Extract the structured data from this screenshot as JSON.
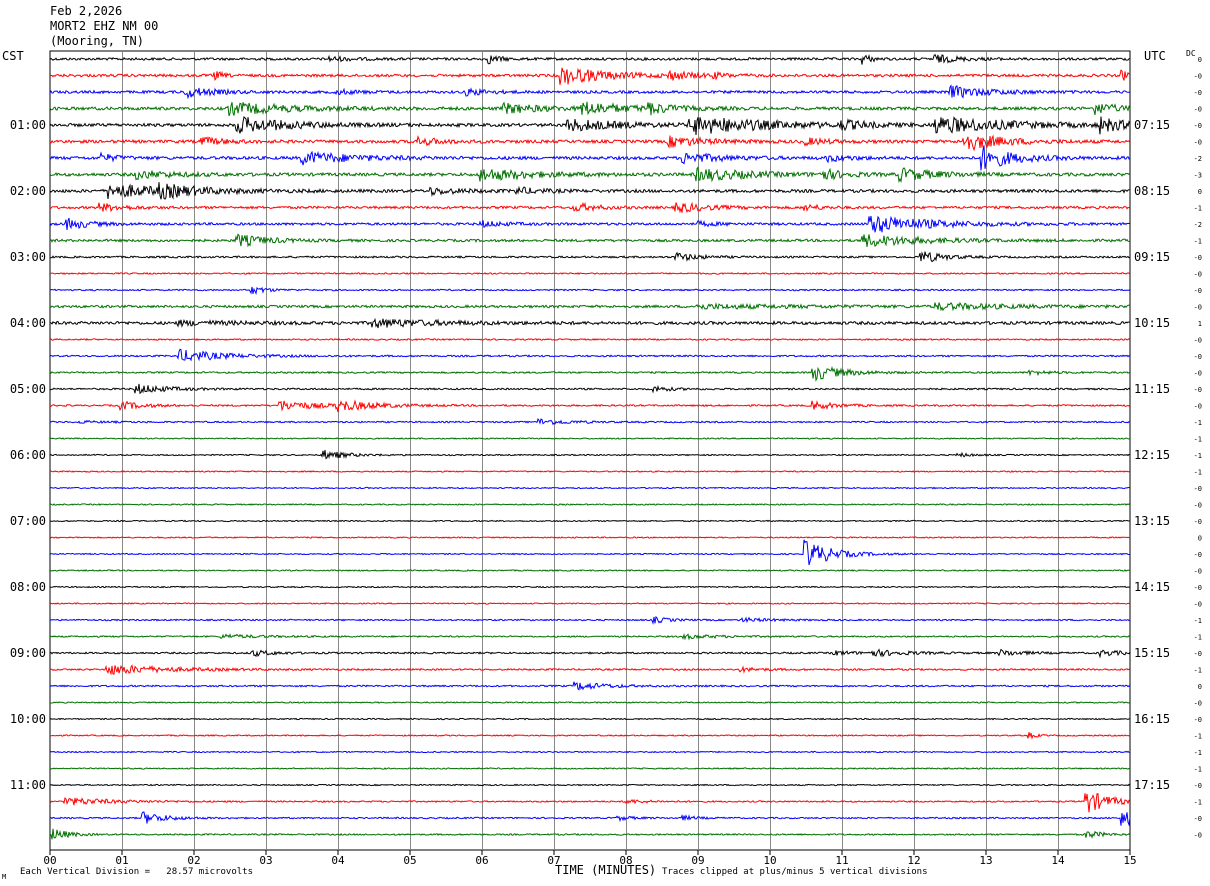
{
  "header": {
    "date": "Feb 2,2026",
    "station": "MORT2 EHZ NM 00",
    "location": "(Mooring, TN)"
  },
  "left_timezone": "CST",
  "right_timezone": "UTC",
  "dc_label": "DC",
  "footer": {
    "scale_note": "Each Vertical Division =   28.57 microvolts",
    "xlabel": "TIME (MINUTES)",
    "clip_note": "Traces clipped at plus/minus 5 vertical divisions",
    "corner_mark": "M"
  },
  "chart_data": {
    "type": "line",
    "xlabel": "TIME (MINUTES)",
    "xlim": [
      0,
      15
    ],
    "x_ticks": [
      "00",
      "01",
      "02",
      "03",
      "04",
      "05",
      "06",
      "07",
      "08",
      "09",
      "10",
      "11",
      "12",
      "13",
      "14",
      "15"
    ],
    "trace_colors": [
      "#000000",
      "#ff0000",
      "#0000ff",
      "#007000"
    ],
    "left_hour_labels": [
      "01:00",
      "02:00",
      "03:00",
      "04:00",
      "05:00",
      "06:00",
      "07:00",
      "08:00",
      "09:00",
      "10:00",
      "11:00"
    ],
    "right_hour_labels": [
      "07:15",
      "08:15",
      "09:15",
      "10:15",
      "11:15",
      "12:15",
      "13:15",
      "14:15",
      "15:15",
      "16:15",
      "17:15"
    ],
    "dc_offsets": [
      "0",
      "-0",
      "-0",
      "-0",
      "-0",
      "-0",
      "-2",
      "-3",
      "0",
      "-1",
      "-2",
      "-1",
      "-0",
      "-0",
      "-0",
      "-0",
      "1",
      "-0",
      "-0",
      "-0",
      "-0",
      "-0",
      "-1",
      "-1",
      "-1",
      "-1",
      "-0",
      "-0",
      "-0",
      "0",
      "-0",
      "-0",
      "-0",
      "-0",
      "-1",
      "-1",
      "-0",
      "-1",
      "0",
      "-0",
      "-0",
      "-1",
      "-1",
      "-1",
      "-0",
      "-1",
      "-0",
      "-0"
    ],
    "series": [
      {
        "trace": 0,
        "base": 1.2,
        "events": [
          {
            "x": 6.1,
            "amp": 4,
            "dur": 0.15
          },
          {
            "x": 11.3,
            "amp": 5,
            "dur": 0.1
          },
          {
            "x": 12.3,
            "amp": 4,
            "dur": 0.3
          },
          {
            "x": 3.9,
            "amp": 2,
            "dur": 0.3
          }
        ]
      },
      {
        "trace": 1,
        "base": 1.3,
        "events": [
          {
            "x": 7.1,
            "amp": 9,
            "dur": 0.6
          },
          {
            "x": 2.3,
            "amp": 4,
            "dur": 0.1
          },
          {
            "x": 8.6,
            "amp": 4,
            "dur": 0.3
          },
          {
            "x": 9.2,
            "amp": 2,
            "dur": 0.2
          },
          {
            "x": 14.9,
            "amp": 4,
            "dur": 0.3
          }
        ]
      },
      {
        "trace": 2,
        "base": 1.3,
        "events": [
          {
            "x": 1.9,
            "amp": 5,
            "dur": 0.35
          },
          {
            "x": 4.0,
            "amp": 2,
            "dur": 0.3
          },
          {
            "x": 5.8,
            "amp": 3,
            "dur": 0.3
          },
          {
            "x": 12.5,
            "amp": 6,
            "dur": 0.5
          }
        ]
      },
      {
        "trace": 3,
        "base": 1.5,
        "events": [
          {
            "x": 2.5,
            "amp": 6,
            "dur": 0.8
          },
          {
            "x": 6.3,
            "amp": 5,
            "dur": 0.5
          },
          {
            "x": 7.4,
            "amp": 6,
            "dur": 0.6
          },
          {
            "x": 8.3,
            "amp": 5,
            "dur": 0.3
          },
          {
            "x": 14.5,
            "amp": 6,
            "dur": 0.3
          }
        ]
      },
      {
        "trace": 4,
        "base": 1.5,
        "events": [
          {
            "x": 2.6,
            "amp": 8,
            "dur": 0.7
          },
          {
            "x": 7.2,
            "amp": 6,
            "dur": 0.7
          },
          {
            "x": 8.9,
            "amp": 9,
            "dur": 1.0
          },
          {
            "x": 12.3,
            "amp": 8,
            "dur": 1.0
          },
          {
            "x": 14.6,
            "amp": 7,
            "dur": 0.3
          },
          {
            "x": 11.0,
            "amp": 4,
            "dur": 0.3
          }
        ]
      },
      {
        "trace": 5,
        "base": 1.5,
        "events": [
          {
            "x": 2.1,
            "amp": 4,
            "dur": 0.3
          },
          {
            "x": 5.1,
            "amp": 4,
            "dur": 0.3
          },
          {
            "x": 8.6,
            "amp": 5,
            "dur": 0.5
          },
          {
            "x": 12.7,
            "amp": 9,
            "dur": 0.5
          },
          {
            "x": 10.5,
            "amp": 3,
            "dur": 0.3
          }
        ]
      },
      {
        "trace": 6,
        "base": 1.5,
        "events": [
          {
            "x": 0.7,
            "amp": 4,
            "dur": 0.2
          },
          {
            "x": 3.5,
            "amp": 6,
            "dur": 0.7
          },
          {
            "x": 8.8,
            "amp": 5,
            "dur": 0.5
          },
          {
            "x": 12.95,
            "amp": 12,
            "dur": 0.4
          },
          {
            "x": 10.8,
            "amp": 3,
            "dur": 0.3
          }
        ]
      },
      {
        "trace": 7,
        "base": 1.5,
        "events": [
          {
            "x": 1.2,
            "amp": 4,
            "dur": 0.5
          },
          {
            "x": 6.0,
            "amp": 6,
            "dur": 0.7
          },
          {
            "x": 9.0,
            "amp": 6,
            "dur": 0.7
          },
          {
            "x": 10.7,
            "amp": 5,
            "dur": 0.3
          },
          {
            "x": 11.8,
            "amp": 6,
            "dur": 0.5
          }
        ]
      },
      {
        "trace": 8,
        "base": 1.5,
        "events": [
          {
            "x": 0.8,
            "amp": 7,
            "dur": 0.8
          },
          {
            "x": 1.5,
            "amp": 5,
            "dur": 0.5
          },
          {
            "x": 5.3,
            "amp": 3,
            "dur": 0.4
          },
          {
            "x": 6.5,
            "amp": 3,
            "dur": 0.3
          }
        ]
      },
      {
        "trace": 9,
        "base": 1.2,
        "events": [
          {
            "x": 0.7,
            "amp": 4,
            "dur": 0.3
          },
          {
            "x": 7.3,
            "amp": 4,
            "dur": 0.3
          },
          {
            "x": 8.7,
            "amp": 5,
            "dur": 0.4
          },
          {
            "x": 10.5,
            "amp": 3,
            "dur": 0.2
          }
        ]
      },
      {
        "trace": 10,
        "base": 1.2,
        "events": [
          {
            "x": 0.25,
            "amp": 5,
            "dur": 0.3
          },
          {
            "x": 6.0,
            "amp": 3,
            "dur": 0.3
          },
          {
            "x": 11.4,
            "amp": 9,
            "dur": 0.8
          },
          {
            "x": 9.0,
            "amp": 2,
            "dur": 0.3
          }
        ]
      },
      {
        "trace": 11,
        "base": 1.2,
        "events": [
          {
            "x": 2.6,
            "amp": 6,
            "dur": 0.4
          },
          {
            "x": 11.3,
            "amp": 6,
            "dur": 0.8
          }
        ]
      },
      {
        "trace": 12,
        "base": 0.9,
        "events": [
          {
            "x": 8.7,
            "amp": 4,
            "dur": 0.3
          },
          {
            "x": 12.1,
            "amp": 6,
            "dur": 0.3
          }
        ]
      },
      {
        "trace": 13,
        "base": 0.7,
        "events": []
      },
      {
        "trace": 14,
        "base": 0.7,
        "events": [
          {
            "x": 2.8,
            "amp": 4,
            "dur": 0.2
          }
        ]
      },
      {
        "trace": 15,
        "base": 1.2,
        "events": [
          {
            "x": 9.0,
            "amp": 2,
            "dur": 1.5
          },
          {
            "x": 12.3,
            "amp": 3,
            "dur": 1.0
          }
        ]
      },
      {
        "trace": 16,
        "base": 1.5,
        "events": [
          {
            "x": 4.5,
            "amp": 4,
            "dur": 0.8
          },
          {
            "x": 1.8,
            "amp": 2,
            "dur": 0.8
          }
        ]
      },
      {
        "trace": 17,
        "base": 0.7,
        "events": []
      },
      {
        "trace": 18,
        "base": 0.8,
        "events": [
          {
            "x": 1.8,
            "amp": 6,
            "dur": 0.6
          }
        ]
      },
      {
        "trace": 19,
        "base": 0.8,
        "events": [
          {
            "x": 10.6,
            "amp": 8,
            "dur": 0.4
          },
          {
            "x": 13.6,
            "amp": 2,
            "dur": 0.3
          }
        ]
      },
      {
        "trace": 20,
        "base": 0.8,
        "events": [
          {
            "x": 1.2,
            "amp": 5,
            "dur": 0.4
          },
          {
            "x": 8.4,
            "amp": 3,
            "dur": 0.2
          }
        ]
      },
      {
        "trace": 21,
        "base": 0.8,
        "events": [
          {
            "x": 1.0,
            "amp": 4,
            "dur": 0.3
          },
          {
            "x": 3.2,
            "amp": 5,
            "dur": 0.5
          },
          {
            "x": 4.0,
            "amp": 5,
            "dur": 0.5
          },
          {
            "x": 10.6,
            "amp": 4,
            "dur": 0.3
          }
        ]
      },
      {
        "trace": 22,
        "base": 0.7,
        "events": [
          {
            "x": 6.8,
            "amp": 3,
            "dur": 0.4
          },
          {
            "x": 0.4,
            "amp": 1,
            "dur": 0.4
          }
        ]
      },
      {
        "trace": 23,
        "base": 0.6,
        "events": []
      },
      {
        "trace": 24,
        "base": 0.6,
        "events": [
          {
            "x": 3.8,
            "amp": 5,
            "dur": 0.3
          },
          {
            "x": 12.6,
            "amp": 2,
            "dur": 0.2
          }
        ]
      },
      {
        "trace": 25,
        "base": 0.6,
        "events": []
      },
      {
        "trace": 26,
        "base": 0.6,
        "events": []
      },
      {
        "trace": 27,
        "base": 0.6,
        "events": []
      },
      {
        "trace": 28,
        "base": 0.6,
        "events": []
      },
      {
        "trace": 29,
        "base": 0.6,
        "events": []
      },
      {
        "trace": 30,
        "base": 0.6,
        "events": [
          {
            "x": 10.5,
            "amp": 14,
            "dur": 0.35
          }
        ]
      },
      {
        "trace": 31,
        "base": 0.6,
        "events": []
      },
      {
        "trace": 32,
        "base": 0.6,
        "events": []
      },
      {
        "trace": 33,
        "base": 0.6,
        "events": []
      },
      {
        "trace": 34,
        "base": 0.7,
        "events": [
          {
            "x": 8.4,
            "amp": 3,
            "dur": 0.2
          },
          {
            "x": 9.6,
            "amp": 2,
            "dur": 0.4
          }
        ]
      },
      {
        "trace": 35,
        "base": 0.7,
        "events": [
          {
            "x": 2.4,
            "amp": 2,
            "dur": 0.5
          },
          {
            "x": 8.8,
            "amp": 2,
            "dur": 0.5
          }
        ]
      },
      {
        "trace": 36,
        "base": 0.8,
        "events": [
          {
            "x": 2.8,
            "amp": 3,
            "dur": 0.3
          },
          {
            "x": 11.4,
            "amp": 3,
            "dur": 0.5
          },
          {
            "x": 13.2,
            "amp": 3,
            "dur": 0.3
          },
          {
            "x": 14.6,
            "amp": 3,
            "dur": 0.3
          },
          {
            "x": 10.9,
            "amp": 2,
            "dur": 0.3
          }
        ]
      },
      {
        "trace": 37,
        "base": 0.8,
        "events": [
          {
            "x": 0.8,
            "amp": 5,
            "dur": 0.8
          },
          {
            "x": 9.6,
            "amp": 2,
            "dur": 0.3
          }
        ]
      },
      {
        "trace": 38,
        "base": 0.8,
        "events": [
          {
            "x": 7.3,
            "amp": 4,
            "dur": 0.4
          }
        ]
      },
      {
        "trace": 39,
        "base": 0.6,
        "events": []
      },
      {
        "trace": 40,
        "base": 0.6,
        "events": []
      },
      {
        "trace": 41,
        "base": 0.6,
        "events": [
          {
            "x": 13.6,
            "amp": 3,
            "dur": 0.1
          }
        ]
      },
      {
        "trace": 42,
        "base": 0.6,
        "events": []
      },
      {
        "trace": 43,
        "base": 0.6,
        "events": []
      },
      {
        "trace": 44,
        "base": 0.6,
        "events": []
      },
      {
        "trace": 45,
        "base": 0.7,
        "events": [
          {
            "x": 0.2,
            "amp": 4,
            "dur": 0.6
          },
          {
            "x": 14.4,
            "amp": 12,
            "dur": 0.3
          },
          {
            "x": 8.0,
            "amp": 2,
            "dur": 0.3
          }
        ]
      },
      {
        "trace": 46,
        "base": 0.7,
        "events": [
          {
            "x": 1.3,
            "amp": 6,
            "dur": 0.3
          },
          {
            "x": 14.9,
            "amp": 8,
            "dur": 0.3
          },
          {
            "x": 7.9,
            "amp": 2,
            "dur": 0.2
          },
          {
            "x": 8.8,
            "amp": 2,
            "dur": 0.2
          }
        ]
      },
      {
        "trace": 47,
        "base": 0.7,
        "events": [
          {
            "x": 0.05,
            "amp": 6,
            "dur": 0.2
          },
          {
            "x": 14.4,
            "amp": 4,
            "dur": 0.2
          }
        ]
      }
    ]
  }
}
